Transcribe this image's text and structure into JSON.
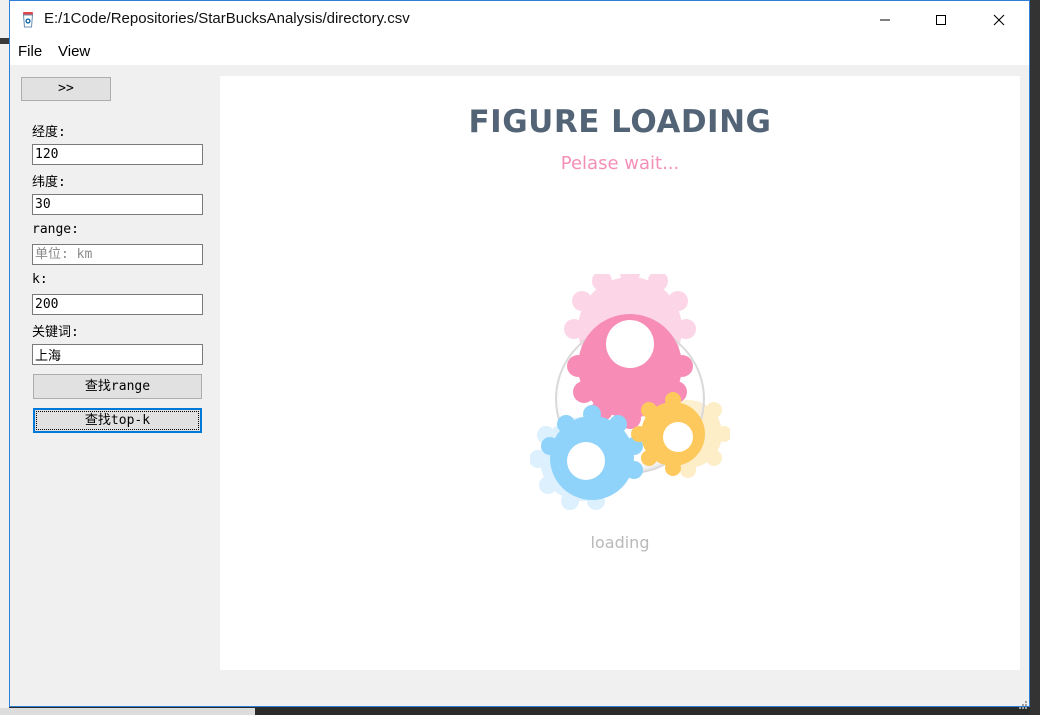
{
  "window": {
    "title": "E:/1Code/Repositories/StarBucksAnalysis/directory.csv"
  },
  "menu": {
    "file": "File",
    "view": "View"
  },
  "sidebar": {
    "toggle_label": ">>",
    "longitude_label": "经度:",
    "longitude_value": "120",
    "latitude_label": "纬度:",
    "latitude_value": "30",
    "range_label": "range:",
    "range_value": "",
    "range_placeholder": "单位: km",
    "k_label": "k:",
    "k_value": "200",
    "keyword_label": "关键词:",
    "keyword_value": "上海",
    "find_range_button": "查找range",
    "find_topk_button": "查找top-k"
  },
  "figure": {
    "title": "FIGURE LOADING",
    "subtitle": "Pelase wait...",
    "loading_text": "loading"
  },
  "colors": {
    "accent_blue": "#0078d7",
    "title_color": "#526476",
    "subtitle_pink": "#f48fb8",
    "gear_pink": "#f78db7",
    "gear_blue": "#8fd3fb",
    "gear_yellow": "#fdc95d"
  },
  "icons": {
    "app": "starbucks-cup-icon",
    "minimize": "minimize-icon",
    "maximize": "maximize-icon",
    "close": "close-icon",
    "gears": "gears-loading-icon",
    "grip": "resize-grip-icon"
  }
}
